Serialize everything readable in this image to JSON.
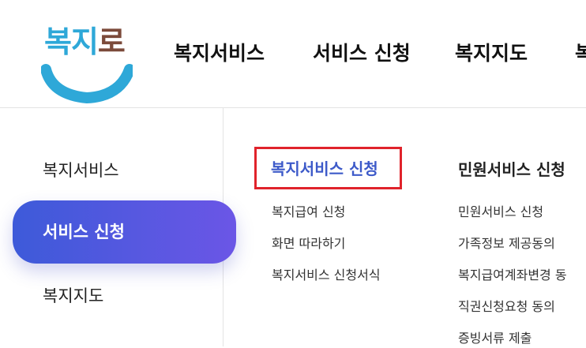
{
  "logo": {
    "text_main": "복지",
    "text_ro": "로"
  },
  "topnav": {
    "items": [
      "복지서비스",
      "서비스 신청",
      "복지지도",
      "복"
    ]
  },
  "sidebar": {
    "items": [
      {
        "label": "복지서비스"
      },
      {
        "label": "서비스 신청",
        "active": true
      },
      {
        "label": "복지지도"
      }
    ]
  },
  "submenu": {
    "columns": [
      {
        "title": "복지서비스 신청",
        "highlighted": true,
        "items": [
          "복지급여 신청",
          "화면 따라하기",
          "복지서비스 신청서식"
        ]
      },
      {
        "title": "민원서비스 신청",
        "items": [
          "민원서비스 신청",
          "가족정보 제공동의",
          "복지급여계좌변경 동",
          "직권신청요청 동의",
          "증빙서류 제출"
        ]
      }
    ]
  },
  "colors": {
    "accent_start": "#3d5ad9",
    "accent_end": "#6b56e6",
    "highlight_border": "#e0232b",
    "active_title": "#3d5ac9",
    "logo_blue": "#2ea8d8",
    "logo_brown": "#7b4a3a"
  }
}
